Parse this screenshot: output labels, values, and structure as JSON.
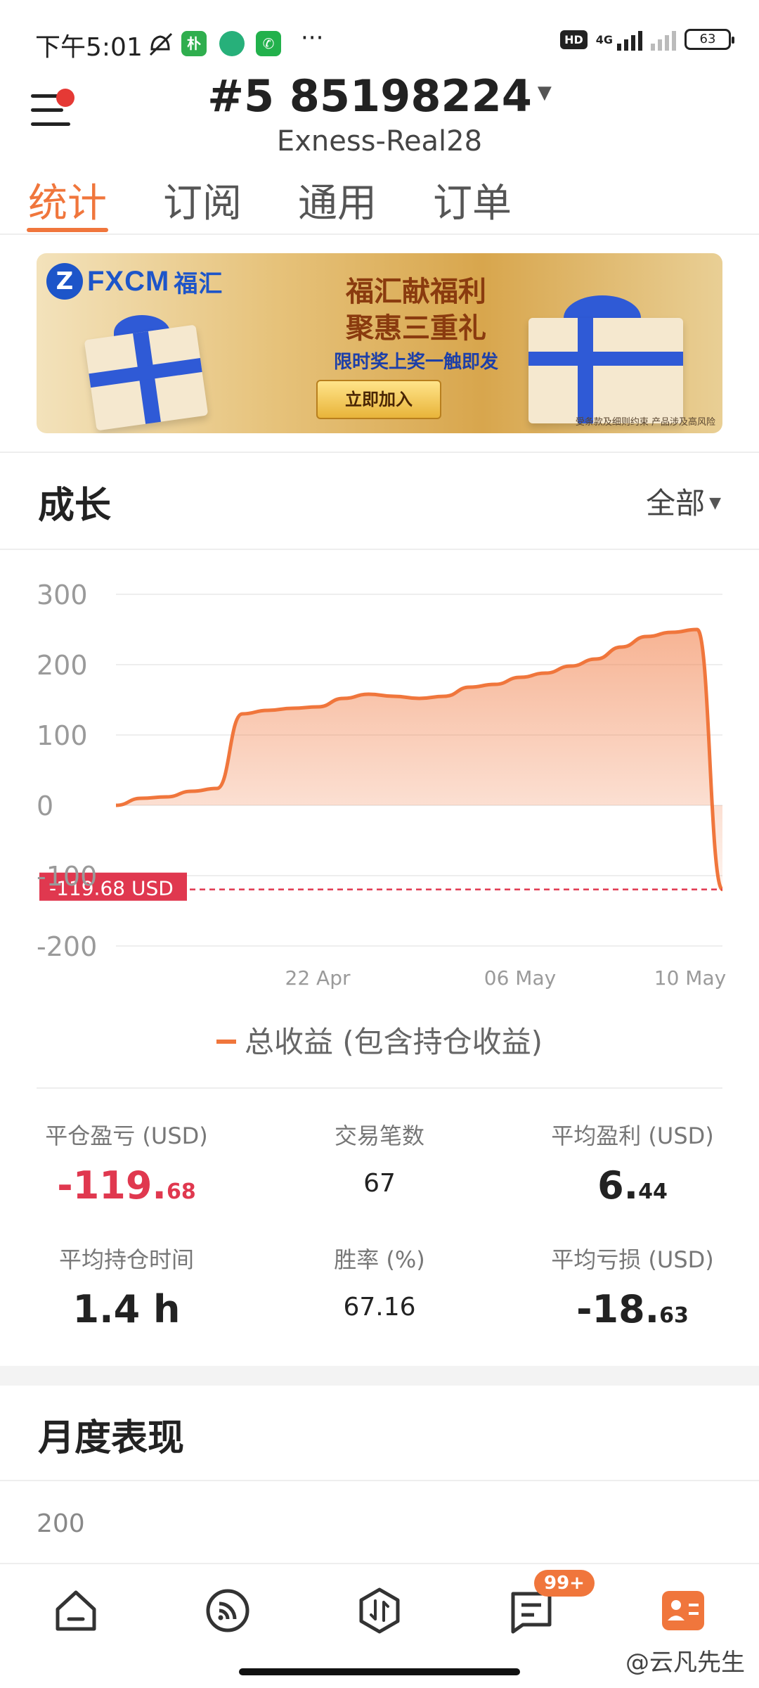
{
  "status_bar": {
    "time": "下午5:01",
    "network": "4G",
    "hd": "HD",
    "battery": "63",
    "more": "···",
    "icons": [
      "mute-icon",
      "app-icon-pu",
      "app-icon-globe",
      "phone-icon"
    ]
  },
  "header": {
    "account_id": "#5  85198224",
    "server": "Exness-Real28"
  },
  "tabs": [
    "统计",
    "订阅",
    "通用",
    "订单"
  ],
  "banner": {
    "brand": "FXCM",
    "brand_cn": "福汇",
    "line1": "福汇献福利",
    "line2": "聚惠三重礼",
    "line3": "限时奖上奖一触即发",
    "button": "立即加入",
    "disclaimer": "受条款及细则约束  产品涉及高风险"
  },
  "growth": {
    "title": "成长",
    "filter": "全部",
    "current_label": "-119.68 USD",
    "legend": "总收益 (包含持仓收益)"
  },
  "chart_data": {
    "type": "area",
    "series": [
      {
        "name": "总收益 (包含持仓收益)",
        "values": [
          0,
          10,
          12,
          20,
          24,
          130,
          135,
          138,
          140,
          152,
          158,
          155,
          152,
          155,
          168,
          172,
          182,
          188,
          198,
          208,
          225,
          240,
          246,
          250,
          -119.68
        ]
      }
    ],
    "y_ticks": [
      "300",
      "200",
      "100",
      "0",
      "-100",
      "-200"
    ],
    "x_ticks": [
      "22 Apr",
      "06 May",
      "10 May"
    ],
    "ylim": [
      -200,
      300
    ],
    "color": "#f0763c",
    "marker_line_color": "#e0384f"
  },
  "stats": {
    "closed_pl": {
      "label": "平仓盈亏 (USD)",
      "int": "-119.",
      "dec": "68"
    },
    "trades": {
      "label": "交易笔数",
      "value": "67"
    },
    "avg_profit": {
      "label": "平均盈利 (USD)",
      "int": "6.",
      "dec": "44"
    },
    "avg_hold": {
      "label": "平均持仓时间",
      "value": "1.4 h"
    },
    "win_rate": {
      "label": "胜率 (%)",
      "value": "67.16"
    },
    "avg_loss": {
      "label": "平均亏损 (USD)",
      "int": "-18.",
      "dec": "63"
    }
  },
  "monthly": {
    "title": "月度表现",
    "y_tick": "200"
  },
  "bottom_nav": {
    "badge": "99+",
    "items": [
      "home-icon",
      "signal-icon",
      "trade-icon",
      "messages-icon",
      "profile-icon"
    ]
  },
  "watermark": "@云凡先生",
  "colors": {
    "accent": "#f0763c",
    "negative": "#e0384f"
  }
}
